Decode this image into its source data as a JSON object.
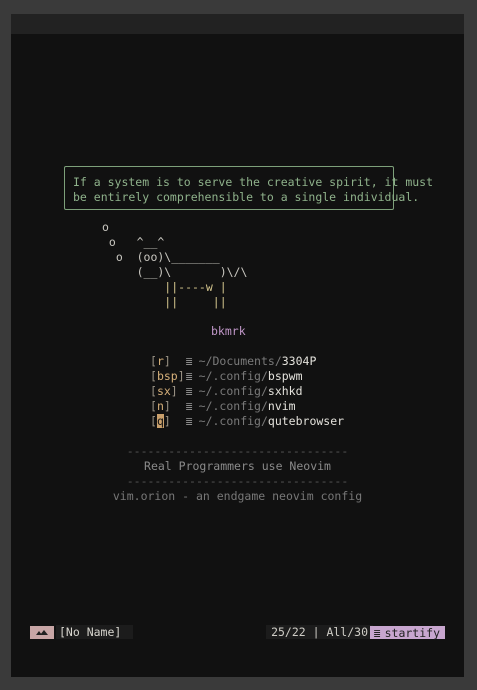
{
  "quote": {
    "line1": "If a system is to serve the creative spirit, it must",
    "line2": "be entirely comprehensible to a single individual."
  },
  "cow": {
    "lines": [
      "o",
      " o   ^__^",
      "  o  (oo)\\_______",
      "     (__)\\       )\\/\\",
      "         ||----w |",
      "         ||     ||"
    ]
  },
  "bookmarks": {
    "header": "bkmrk",
    "entries": [
      {
        "key": "r",
        "dir": "~/Documents/",
        "name": "3304P"
      },
      {
        "key": "bsp",
        "dir": "~/.config/",
        "name": "bspwm"
      },
      {
        "key": "sx",
        "dir": "~/.config/",
        "name": "sxhkd"
      },
      {
        "key": "n",
        "dir": "~/.config/",
        "name": "nvim"
      },
      {
        "key": "q",
        "dir": "~/.config/",
        "name": "qutebrowser"
      }
    ]
  },
  "footer": {
    "separator": "--------------------------------",
    "line1": "Real Programmers use Neovim",
    "line2": "vim.orion - an endgame neovim config"
  },
  "statusline": {
    "mode_icon": "mountain-icon",
    "filename": "[No Name]",
    "position": "25/22 | All/30",
    "filetype_icon": "list-icon",
    "filetype": "startify"
  },
  "colors": {
    "background": "#111111",
    "quote": "#8fb28b",
    "accent_pink": "#c8a6a6",
    "accent_purple": "#c8a6cf",
    "key": "#d6b07a"
  }
}
